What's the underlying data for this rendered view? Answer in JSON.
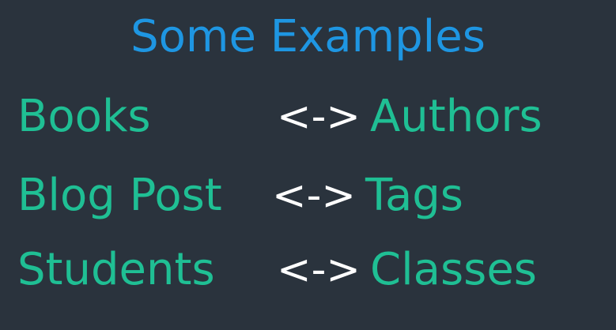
{
  "slide": {
    "title": "Some Examples",
    "colors": {
      "background": "#2a333d",
      "title": "#1e96e2",
      "term": "#1fbf94",
      "arrow": "#ffffff"
    },
    "rows": [
      {
        "left": "Books",
        "arrow": "<->",
        "right": "Authors"
      },
      {
        "left": "Blog Post",
        "arrow": "<->",
        "right": "Tags"
      },
      {
        "left": "Students",
        "arrow": "<->",
        "right": "Classes"
      }
    ]
  }
}
